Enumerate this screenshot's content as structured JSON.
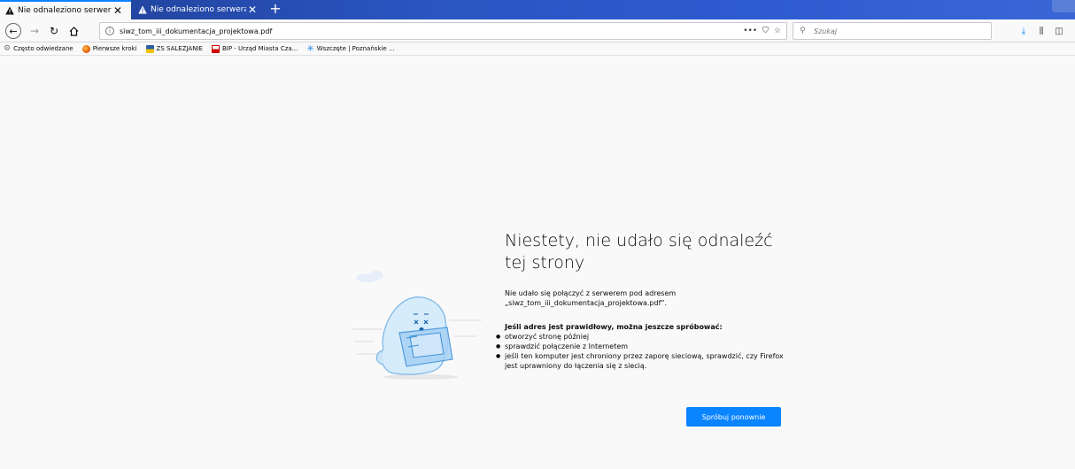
{
  "tabs": [
    {
      "title": "Nie odnaleziono serwera",
      "active": true
    },
    {
      "title": "Nie odnaleziono serwera",
      "active": false
    }
  ],
  "newtab_symbol": "+",
  "urlbar": {
    "url": "siwz_tom_iii_dokumentacja_projektowa.pdf",
    "actions": [
      "•••",
      "⛉",
      "☆"
    ]
  },
  "search": {
    "placeholder": "Szukaj"
  },
  "bookmarks": [
    {
      "label": "Często odwiedzane",
      "icon": "gear-icon",
      "color": "#737373"
    },
    {
      "label": "Pierwsze kroki",
      "icon": "firefox-icon",
      "color": "#e66000"
    },
    {
      "label": "ZS SALEZJANIE",
      "icon": "flag-icon",
      "color": "#2a5ca8"
    },
    {
      "label": "BIP - Urząd Miasta Cza...",
      "icon": "bip-icon",
      "color": "#d40000"
    },
    {
      "label": "Wszczęte | Poznańskie ...",
      "icon": "star-burst-icon",
      "color": "#1e8ae6"
    }
  ],
  "error": {
    "title_line1": "Niestety, nie udało się odnaleźć",
    "title_line2": "tej strony",
    "desc_line1": "Nie udało się połączyć z serwerem pod adresem",
    "desc_line2": "„siwz_tom_iii_dokumentacja_projektowa.pdf”.",
    "subhead": "Jeśli adres jest prawidłowy, można jeszcze spróbować:",
    "suggestions": [
      "otworzyć stronę później",
      "sprawdzić połączenie z Internetem",
      "jeśli ten komputer jest chroniony przez zaporę sieciową, sprawdzić, czy Firefox jest uprawniony do łączenia się z siecią."
    ],
    "retry_label": "Spróbuj ponownie"
  },
  "colors": {
    "accent": "#0a84ff",
    "tabstrip": "#2a55c2"
  }
}
